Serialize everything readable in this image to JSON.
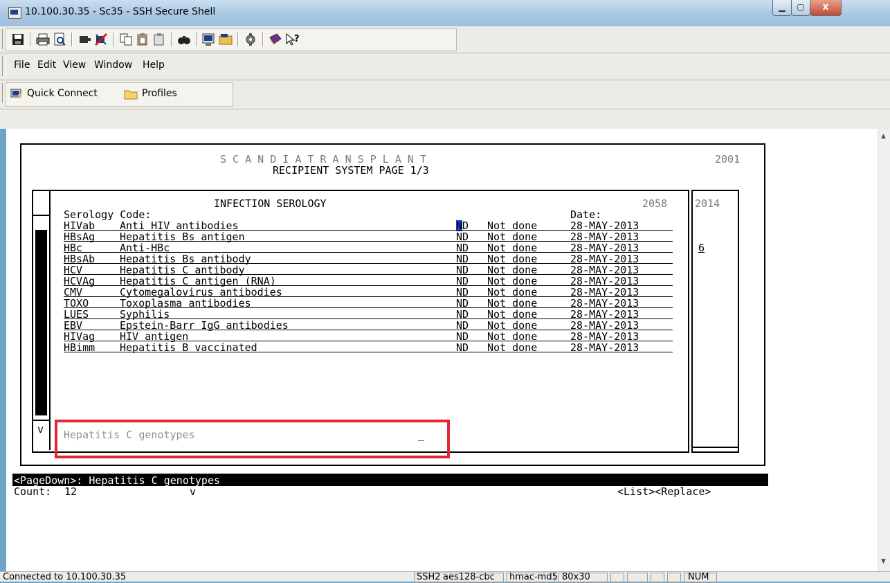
{
  "window": {
    "title": "10.100.30.35 - Sc35 - SSH Secure Shell",
    "minimize": "▁",
    "maximize": "▢",
    "close": "x"
  },
  "menu": {
    "file": "File",
    "edit": "Edit",
    "view": "View",
    "window": "Window",
    "help": "Help"
  },
  "quickbar": {
    "quick_connect": "Quick Connect",
    "profiles": "Profiles"
  },
  "screen": {
    "system_name": "S C A N D I A T R A N S P L A N T",
    "screen_code": "2001",
    "page_title": "RECIPIENT SYSTEM PAGE 1/3",
    "section_title": "INFECTION SEROLOGY",
    "section_code": "2058",
    "side_code": "2014",
    "col_serology": "Serology Code:",
    "col_date": "Date:",
    "rows": [
      {
        "code": "HIVab",
        "name": "Anti HIV antibodies",
        "res": "ND",
        "status": "Not done",
        "date": "28-MAY-2013",
        "side": ""
      },
      {
        "code": "HBsAg",
        "name": "Hepatitis Bs antigen",
        "res": "ND",
        "status": "Not done",
        "date": "28-MAY-2013",
        "side": ""
      },
      {
        "code": "HBc",
        "name": "Anti-HBc",
        "res": "ND",
        "status": "Not done",
        "date": "28-MAY-2013",
        "side": "6"
      },
      {
        "code": "HBsAb",
        "name": "Hepatitis Bs antibody",
        "res": "ND",
        "status": "Not done",
        "date": "28-MAY-2013",
        "side": ""
      },
      {
        "code": "HCV",
        "name": "Hepatitis C antibody",
        "res": "ND",
        "status": "Not done",
        "date": "28-MAY-2013",
        "side": ""
      },
      {
        "code": "HCVAg",
        "name": "Hepatitis C antigen (RNA)",
        "res": "ND",
        "status": "Not done",
        "date": "28-MAY-2013",
        "side": ""
      },
      {
        "code": "CMV",
        "name": "Cytomegalovirus antibodies",
        "res": "ND",
        "status": "Not done",
        "date": "28-MAY-2013",
        "side": ""
      },
      {
        "code": "TOXO",
        "name": "Toxoplasma antibodies",
        "res": "ND",
        "status": "Not done",
        "date": "28-MAY-2013",
        "side": ""
      },
      {
        "code": "LUES",
        "name": "Syphilis",
        "res": "ND",
        "status": "Not done",
        "date": "28-MAY-2013",
        "side": ""
      },
      {
        "code": "EBV",
        "name": "Epstein-Barr IgG antibodies",
        "res": "ND",
        "status": "Not done",
        "date": "28-MAY-2013",
        "side": ""
      },
      {
        "code": "HIVag",
        "name": "HIV antigen",
        "res": "ND",
        "status": "Not done",
        "date": "28-MAY-2013",
        "side": ""
      },
      {
        "code": "HBimm",
        "name": "Hepatitis B vaccinated",
        "res": "ND",
        "status": "Not done",
        "date": "28-MAY-2013",
        "side": ""
      }
    ],
    "genotype_field": "Hepatitis C genotypes",
    "genotype_cursor": "_",
    "scroll_marker": "v",
    "message_line": "<PageDown>: Hepatitis C genotypes",
    "count_label": "Count:",
    "count_value": "12",
    "count_marker": "v",
    "keys": "<List><Replace>",
    "highlight_color": "#e32636"
  },
  "status": {
    "connected": "Connected to 10.100.30.35",
    "protocol": "SSH2",
    "cipher": "aes128-cbc",
    "hmac": "hmac-md5",
    "size": "80x30",
    "num": "NUM"
  }
}
